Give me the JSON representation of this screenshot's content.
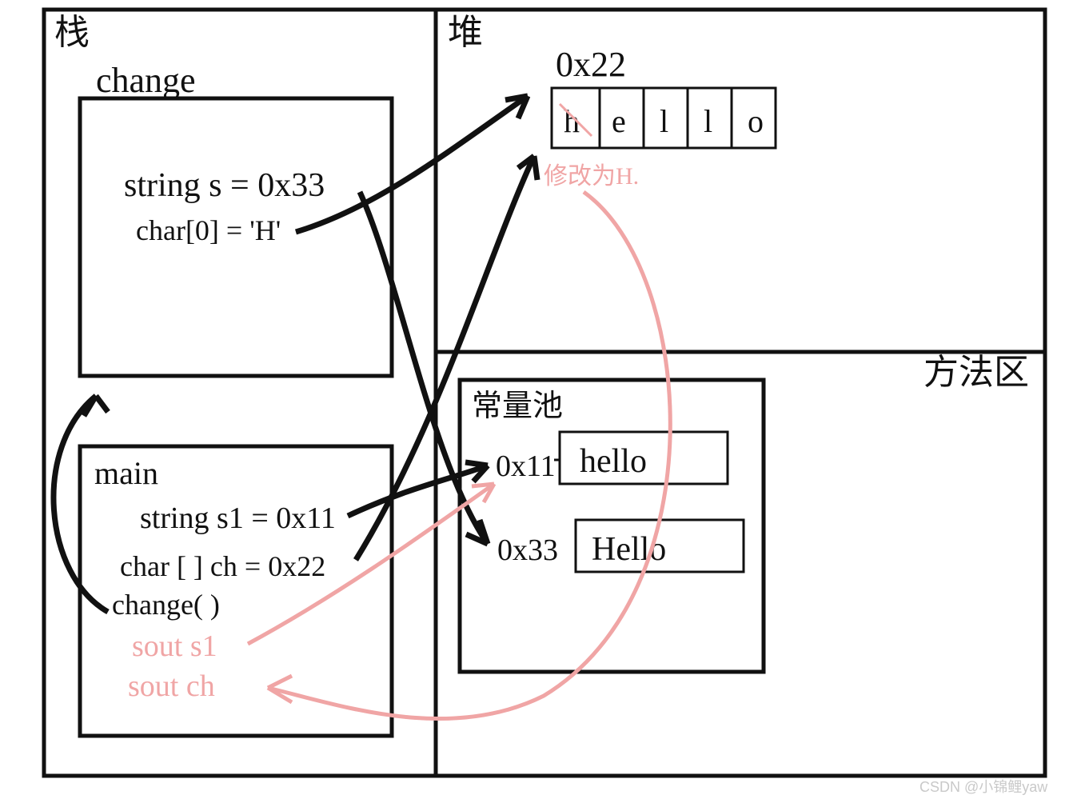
{
  "regions": {
    "stack_label": "栈",
    "heap_label": "堆",
    "method_area_label": "方法区",
    "constant_pool_label": "常量池"
  },
  "heap_array": {
    "address": "0x22",
    "cells": [
      "h",
      "e",
      "l",
      "l",
      "o"
    ],
    "strike_first": true,
    "note_below": "修改为H."
  },
  "constant_pool": {
    "entries": [
      {
        "addr": "0x11",
        "value": "hello"
      },
      {
        "addr": "0x33",
        "value": "Hello"
      }
    ]
  },
  "stack_frames": {
    "change": {
      "title": "change",
      "line1": "string s = 0x33",
      "line2": "char[0] = 'H'"
    },
    "main": {
      "title": "main",
      "line1": "string s1 = 0x11",
      "line2": "char [ ] ch = 0x22",
      "line3": "change( )",
      "line4": "sout s1",
      "line5": "sout ch"
    }
  },
  "watermark": "CSDN @小锦鲤yaw"
}
